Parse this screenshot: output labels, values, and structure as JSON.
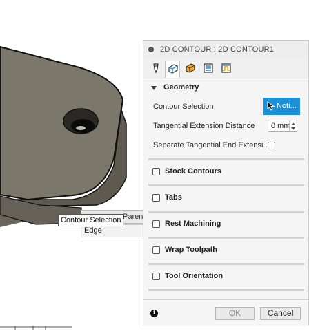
{
  "viewport": {
    "popup": {
      "parents_label": "Parents",
      "row_label": "Edge"
    },
    "tooltip": "Contour Selection"
  },
  "panel": {
    "title": "2D CONTOUR : 2D CONTOUR1",
    "tabs": [
      {
        "icon": "tool-icon"
      },
      {
        "icon": "geometry-icon",
        "active": true
      },
      {
        "icon": "heights-icon"
      },
      {
        "icon": "passes-icon"
      },
      {
        "icon": "linking-icon"
      }
    ],
    "geometry": {
      "title": "Geometry",
      "contour_selection_label": "Contour Selection",
      "selection_button_label": "Noti...",
      "tangential_extension_label": "Tangential Extension Distance",
      "tangential_extension_value": "0 mm",
      "separate_tangential_label": "Separate Tangential End Extensi..."
    },
    "sections": [
      {
        "title": "Stock Contours"
      },
      {
        "title": "Tabs"
      },
      {
        "title": "Rest Machining"
      },
      {
        "title": "Wrap Toolpath"
      },
      {
        "title": "Tool Orientation"
      }
    ],
    "footer": {
      "ok_label": "OK",
      "cancel_label": "Cancel"
    }
  },
  "colors": {
    "part_face": "#7a766a",
    "part_side": "#5f5b51",
    "accent_blue": "#1b8fd8"
  }
}
